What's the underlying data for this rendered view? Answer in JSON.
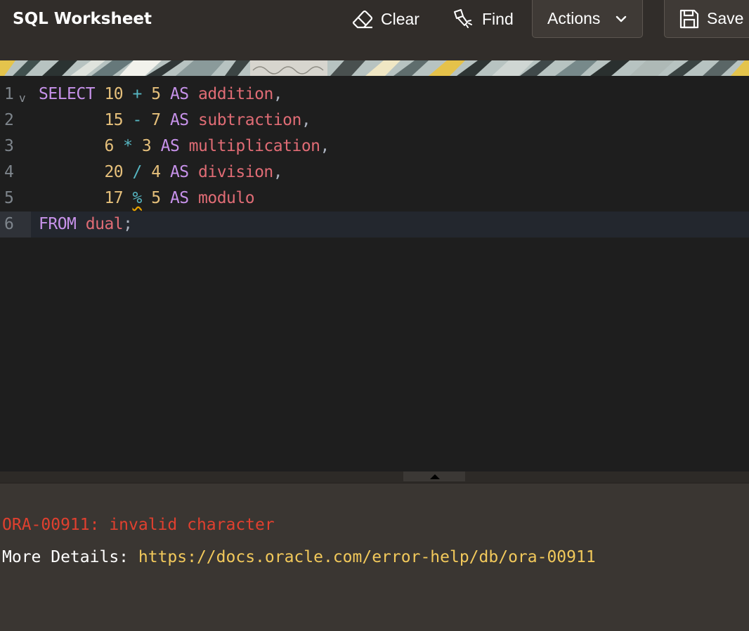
{
  "header": {
    "title": "SQL Worksheet",
    "toolbar": {
      "clear_label": "Clear",
      "find_label": "Find",
      "actions_label": "Actions",
      "save_label": "Save"
    },
    "icons": {
      "clear": "eraser-icon",
      "find": "flashlight-icon",
      "actions": "chevron-down-icon",
      "save": "floppy-disk-icon"
    }
  },
  "editor": {
    "active_line": 6,
    "lines": [
      {
        "number": "1",
        "tokens": [
          "SELECT",
          "10",
          "+",
          "5",
          "AS",
          "addition",
          ","
        ]
      },
      {
        "number": "2",
        "tokens": [
          "15",
          "-",
          "7",
          "AS",
          "subtraction",
          ","
        ]
      },
      {
        "number": "3",
        "tokens": [
          "6",
          "*",
          "3",
          "AS",
          "multiplication",
          ","
        ]
      },
      {
        "number": "4",
        "tokens": [
          "20",
          "/",
          "4",
          "AS",
          "division",
          ","
        ]
      },
      {
        "number": "5",
        "tokens": [
          "17",
          "%",
          "5",
          "AS",
          "modulo"
        ]
      },
      {
        "number": "6",
        "tokens": [
          "FROM",
          "dual",
          ";"
        ]
      }
    ],
    "fold_marker": "v"
  },
  "output": {
    "error": "ORA-00911: invalid character",
    "details_label": "More Details: ",
    "details_link": "https://docs.oracle.com/error-help/db/ora-00911"
  },
  "colors": {
    "header_bg": "#312d2a",
    "editor_bg": "#1e1e1e",
    "keyword": "#c792ea",
    "number": "#e6c07b",
    "identifier": "#e06c75",
    "operator": "#56b6c2",
    "error": "#e0402f",
    "link": "#f2c95b"
  }
}
